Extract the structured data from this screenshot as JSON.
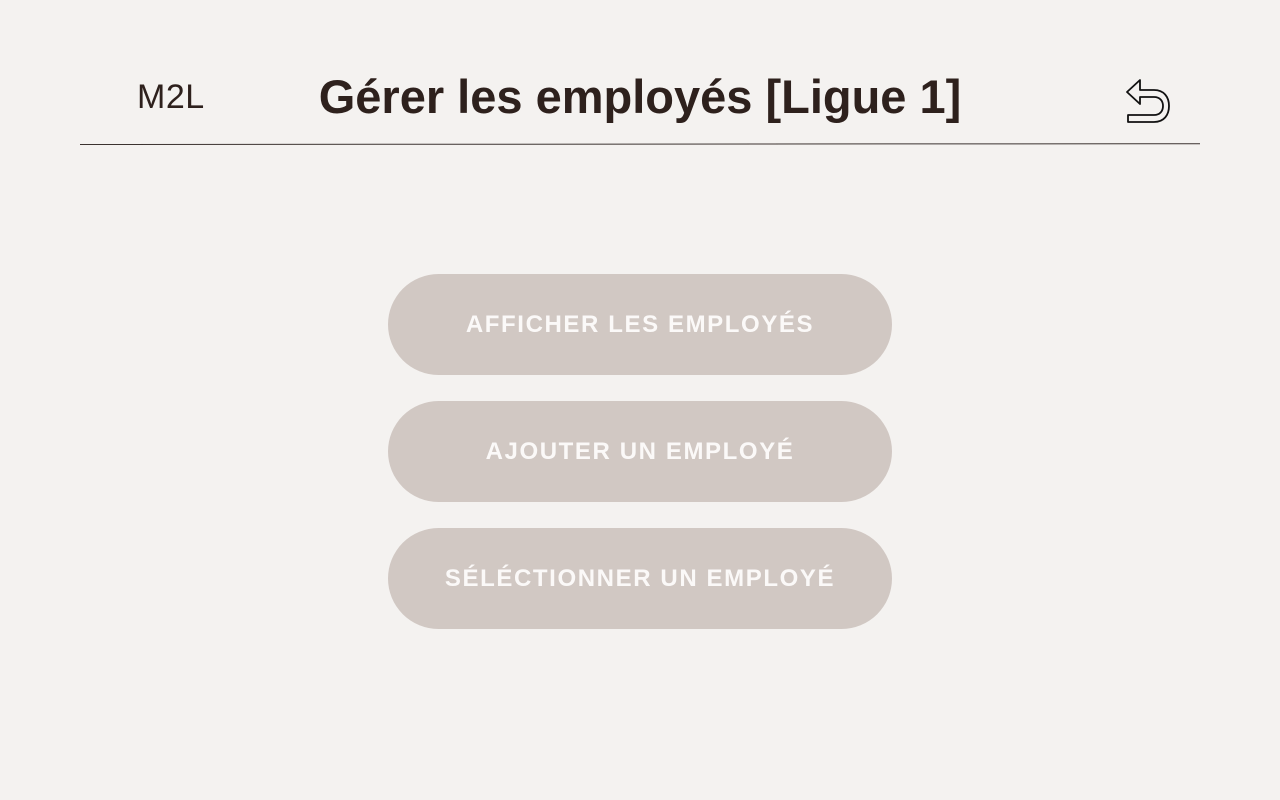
{
  "header": {
    "logo": "M2L",
    "title": "Gérer les employés [Ligue 1]",
    "back_icon": "return-arrow-icon"
  },
  "menu": {
    "items": [
      {
        "label": "AFFICHER LES EMPLOYÉS"
      },
      {
        "label": "AJOUTER UN EMPLOYÉ"
      },
      {
        "label": "SÉLÉCTIONNER UN EMPLOYÉ"
      }
    ]
  },
  "colors": {
    "background": "#f4f2f0",
    "text": "#2e211d",
    "button_bg": "#d1c8c3",
    "button_text": "#fbf9f8"
  }
}
